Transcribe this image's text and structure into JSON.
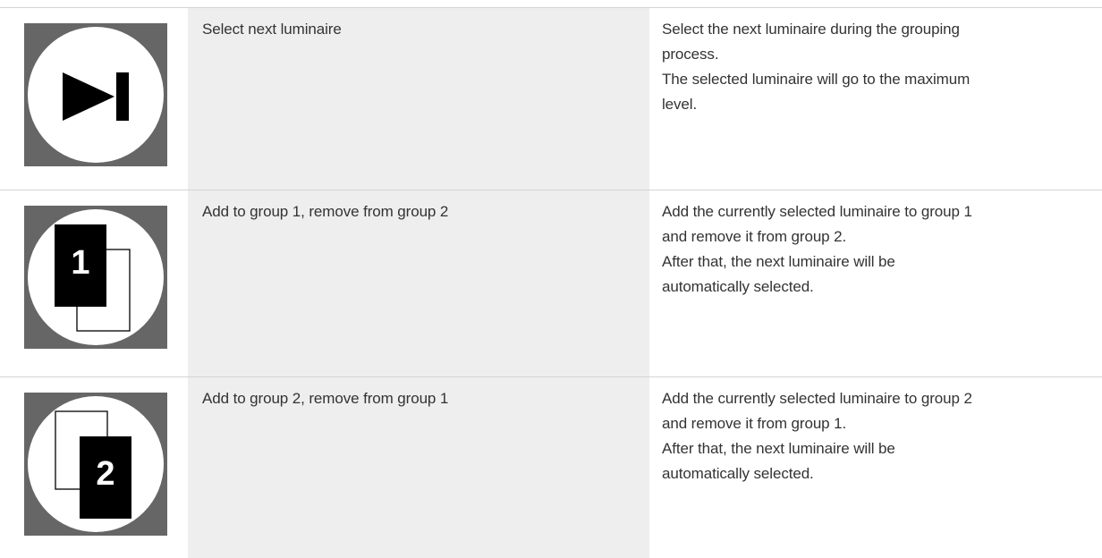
{
  "colors": {
    "icon_background": "#666666",
    "icon_circle": "#ffffff",
    "icon_glyph": "#000000",
    "name_column_background": "#eeeeee",
    "row_divider": "#d4d4d4",
    "text": "#333333"
  },
  "rows": [
    {
      "icon": "skip-next-icon",
      "name": "Select next luminaire",
      "description": [
        "Select the next luminaire during the grouping",
        "process.",
        "The selected luminaire will go to the maximum",
        "level."
      ]
    },
    {
      "icon": "group-1-icon",
      "icon_number": "1",
      "name": "Add to group 1, remove from group 2",
      "description": [
        "Add the currently selected luminaire to group 1",
        "and remove it from group 2.",
        "After that, the next luminaire will be",
        "automatically selected."
      ]
    },
    {
      "icon": "group-2-icon",
      "icon_number": "2",
      "name": "Add to group 2, remove from group 1",
      "description": [
        "Add the currently selected luminaire to group 2",
        "and remove it from group 1.",
        "After that, the next luminaire will be",
        "automatically selected."
      ]
    }
  ]
}
